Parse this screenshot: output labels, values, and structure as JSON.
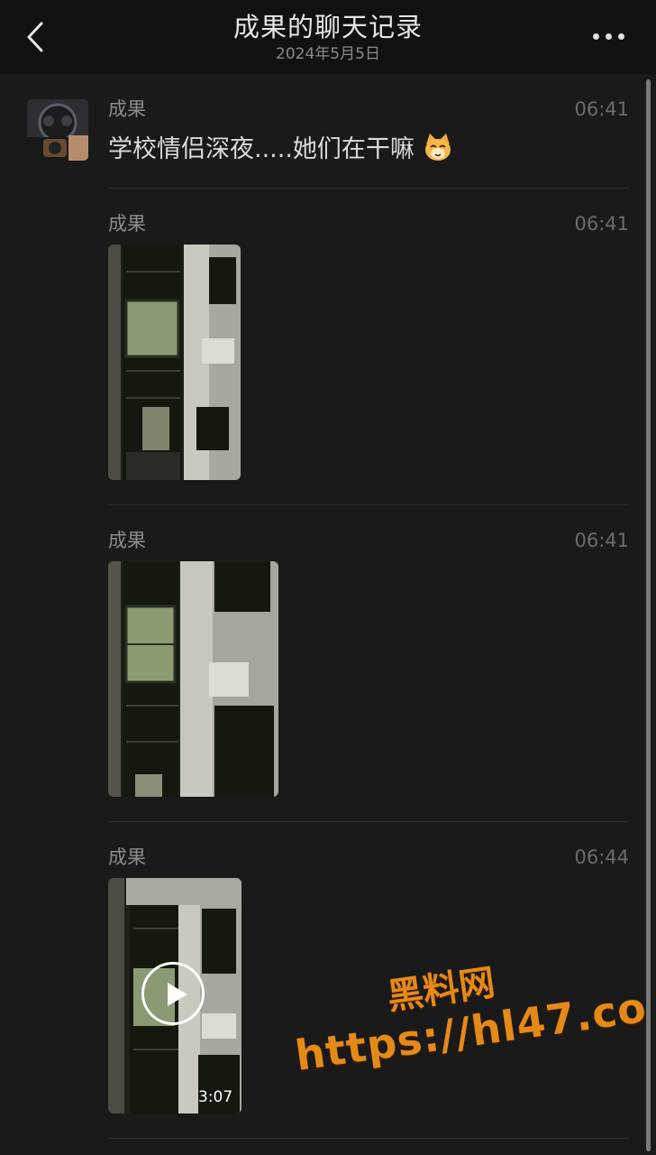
{
  "header": {
    "title": "成果的聊天记录",
    "date": "2024年5月5日",
    "back_icon": "chevron-left-icon",
    "more_icon": "ellipsis-icon"
  },
  "messages": [
    {
      "sender": "成果",
      "time": "06:41",
      "type": "text",
      "text": "学校情侣深夜.....她们在干嘛",
      "emoji": "cat-face-emoji"
    },
    {
      "sender": "成果",
      "time": "06:41",
      "type": "image"
    },
    {
      "sender": "成果",
      "time": "06:41",
      "type": "image"
    },
    {
      "sender": "成果",
      "time": "06:44",
      "type": "video",
      "duration": "3:07"
    }
  ],
  "watermark": {
    "line1": "黑料网",
    "line2": "https://hl47.co"
  },
  "colors": {
    "background": "#1a1a1a",
    "header": "#111111",
    "watermark": "#e58a18"
  }
}
